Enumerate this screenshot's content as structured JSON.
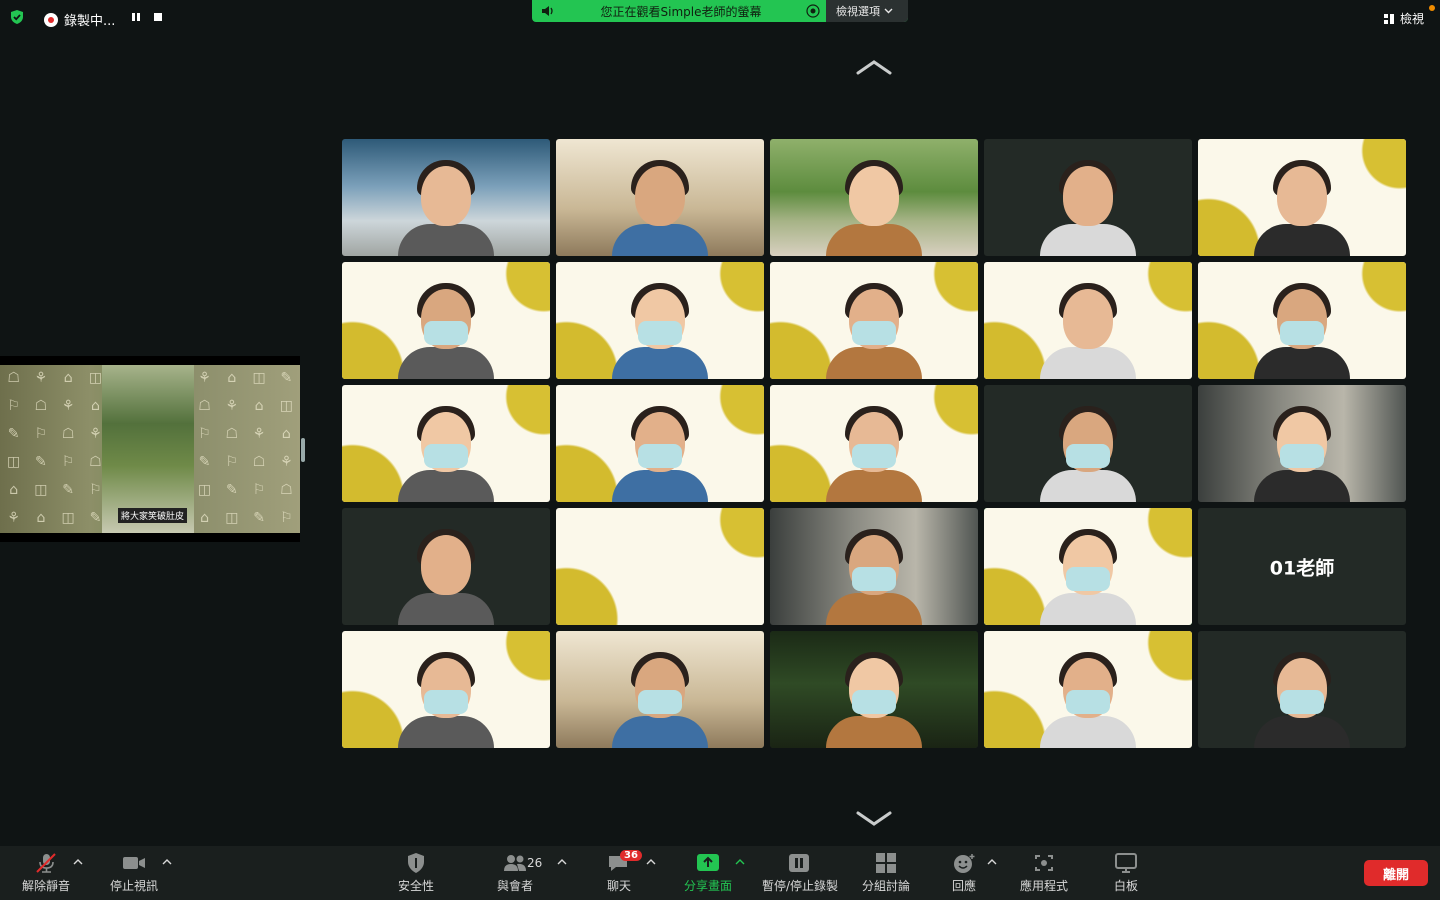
{
  "top": {
    "recording_label": "錄製中...",
    "banner_text": "您正在觀看Simple老師的螢幕",
    "view_options_label": "檢視選項",
    "view_label": "檢視"
  },
  "share": {
    "caption": "將大家笑破肚皮"
  },
  "gallery": {
    "named_tile": "01老師",
    "tiles": [
      {
        "bg": "bg-red",
        "mask": false
      },
      {
        "bg": "bg-room",
        "mask": false
      },
      {
        "bg": "bg-green",
        "mask": false
      },
      {
        "bg": "bg-dark",
        "mask": false
      },
      {
        "bg": "bg-yellow",
        "mask": false
      },
      {
        "bg": "bg-yellow",
        "mask": true
      },
      {
        "bg": "bg-yellow",
        "mask": true
      },
      {
        "bg": "bg-yellow",
        "mask": true
      },
      {
        "bg": "bg-yellow",
        "mask": false
      },
      {
        "bg": "bg-yellow",
        "mask": true
      },
      {
        "bg": "bg-yellow",
        "mask": true
      },
      {
        "bg": "bg-yellow",
        "mask": true
      },
      {
        "bg": "bg-yellow",
        "mask": true
      },
      {
        "bg": "bg-dark",
        "mask": true
      },
      {
        "bg": "bg-office",
        "mask": true
      },
      {
        "bg": "bg-dark",
        "mask": false
      },
      {
        "bg": "bg-yellow",
        "mask": false,
        "empty": true
      },
      {
        "bg": "bg-office",
        "mask": true
      },
      {
        "bg": "bg-yellow",
        "mask": true,
        "active": true
      },
      {
        "bg": "bg-dark",
        "name": true
      },
      {
        "bg": "bg-yellow",
        "mask": true
      },
      {
        "bg": "bg-room",
        "mask": true
      },
      {
        "bg": "bg-night",
        "mask": true
      },
      {
        "bg": "bg-yellow",
        "mask": true
      },
      {
        "bg": "bg-dark",
        "mask": true
      }
    ]
  },
  "toolbar": {
    "unmute": "解除靜音",
    "stop_video": "停止視訊",
    "security": "安全性",
    "participants": "與會者",
    "participants_count": "26",
    "chat": "聊天",
    "chat_badge": "36",
    "share": "分享畫面",
    "record": "暫停/停止錄製",
    "breakout": "分組討論",
    "reactions": "回應",
    "apps": "應用程式",
    "whiteboard": "白板",
    "leave": "離開"
  },
  "colors": {
    "accent_green": "#23c552",
    "danger_red": "#e02b2b",
    "background": "#0f1414"
  }
}
